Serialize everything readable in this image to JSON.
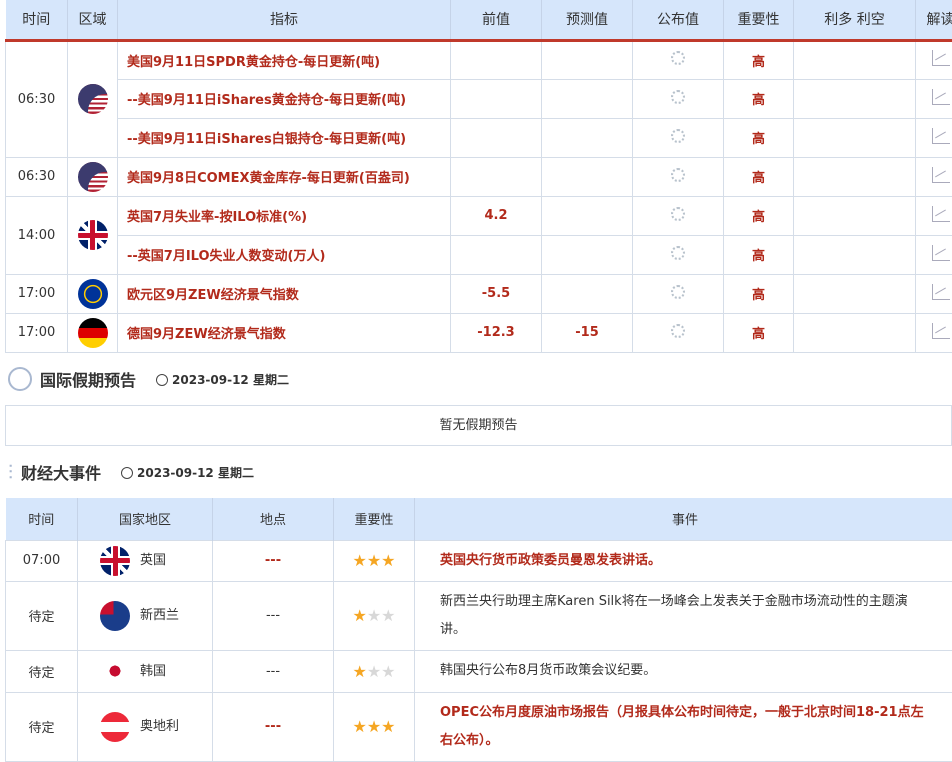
{
  "calendar": {
    "headers": [
      "时间",
      "区域",
      "指标",
      "前值",
      "预测值",
      "公布值",
      "重要性",
      "利多 利空",
      "解读"
    ],
    "groups": [
      {
        "time": "06:30",
        "flag": "us",
        "rows": [
          {
            "indicator": "美国9月11日SPDR黄金持仓-每日更新(吨)",
            "prev": "",
            "forecast": "",
            "importance": "高"
          },
          {
            "indicator": "--美国9月11日iShares黄金持仓-每日更新(吨)",
            "prev": "",
            "forecast": "",
            "importance": "高"
          },
          {
            "indicator": "--美国9月11日iShares白银持仓-每日更新(吨)",
            "prev": "",
            "forecast": "",
            "importance": "高"
          }
        ]
      },
      {
        "time": "06:30",
        "flag": "us",
        "rows": [
          {
            "indicator": "美国9月8日COMEX黄金库存-每日更新(百盎司)",
            "prev": "",
            "forecast": "",
            "importance": "高"
          }
        ]
      },
      {
        "time": "14:00",
        "flag": "uk",
        "rows": [
          {
            "indicator": "英国7月失业率-按ILO标准(%)",
            "prev": "4.2",
            "forecast": "",
            "importance": "高"
          },
          {
            "indicator": "--英国7月ILO失业人数变动(万人)",
            "prev": "",
            "forecast": "",
            "importance": "高"
          }
        ]
      },
      {
        "time": "17:00",
        "flag": "eu",
        "rows": [
          {
            "indicator": "欧元区9月ZEW经济景气指数",
            "prev": "-5.5",
            "forecast": "",
            "importance": "高"
          }
        ]
      },
      {
        "time": "17:00",
        "flag": "de",
        "rows": [
          {
            "indicator": "德国9月ZEW经济景气指数",
            "prev": "-12.3",
            "forecast": "-15",
            "importance": "高"
          }
        ]
      }
    ]
  },
  "holiday": {
    "title": "国际假期预告",
    "date": "2023-09-12 星期二",
    "empty": "暂无假期预告"
  },
  "events": {
    "title": "财经大事件",
    "date": "2023-09-12 星期二",
    "headers": [
      "时间",
      "国家地区",
      "地点",
      "重要性",
      "事件"
    ],
    "rows": [
      {
        "time": "07:00",
        "flag": "uk",
        "country": "英国",
        "place": "---",
        "stars": 3,
        "event": "英国央行货币政策委员曼恩发表讲话。",
        "highlight": true
      },
      {
        "time": "待定",
        "flag": "nz",
        "country": "新西兰",
        "place": "---",
        "stars": 1,
        "event": "新西兰央行助理主席Karen Silk将在一场峰会上发表关于金融市场流动性的主题演讲。",
        "highlight": false
      },
      {
        "time": "待定",
        "flag": "kr",
        "country": "韩国",
        "place": "---",
        "stars": 1,
        "event": "韩国央行公布8月货币政策会议纪要。",
        "highlight": false
      },
      {
        "time": "待定",
        "flag": "at",
        "country": "奥地利",
        "place": "---",
        "stars": 3,
        "event": "OPEC公布月度原油市场报告（月报具体公布时间待定，一般于北京时间18-21点左右公布）。",
        "highlight": true
      }
    ]
  },
  "colors": {
    "accent": "#b22a1b",
    "header_bg": "#d6e6fb",
    "star": "#f5a623"
  }
}
